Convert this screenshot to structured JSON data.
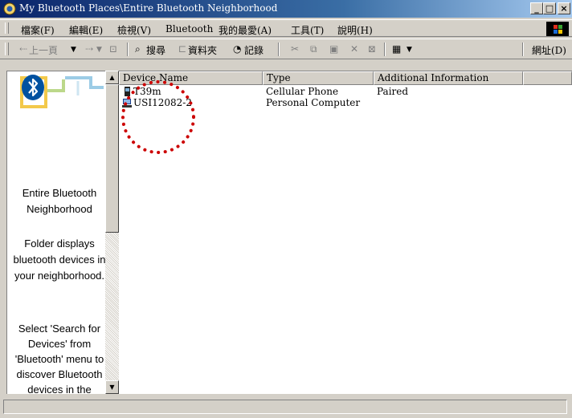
{
  "window": {
    "title": "My Bluetooth Places\\Entire Bluetooth Neighborhood",
    "controls": {
      "minimize": "_",
      "maximize": "□",
      "close": "×"
    }
  },
  "menu": {
    "items": [
      "檔案(F)",
      "編輯(E)",
      "檢視(V)",
      "Bluetooth",
      "我的最愛(A)",
      "工具(T)",
      "說明(H)"
    ]
  },
  "toolbar": {
    "back": "上一頁",
    "search": "搜尋",
    "folders": "資料夾",
    "history": "記錄",
    "address_label": "網址(D)"
  },
  "left_pane": {
    "heading": [
      "Entire Bluetooth",
      "Neighborhood"
    ],
    "description": [
      "Folder displays",
      "bluetooth devices in",
      "your neighborhood."
    ],
    "hint": [
      "Select 'Search for",
      "Devices' from",
      "'Bluetooth' menu to",
      "discover Bluetooth",
      "devices in the"
    ]
  },
  "list": {
    "columns": [
      "Device Name",
      "Type",
      "Additional Information"
    ],
    "rows": [
      {
        "name": "T39m",
        "type": "Cellular Phone",
        "info": "Paired",
        "icon": "cellular-phone-icon"
      },
      {
        "name": "USI12082-2",
        "type": "Personal Computer",
        "info": "",
        "icon": "computer-icon"
      }
    ]
  },
  "colors": {
    "title_bar_start": "#0a246a",
    "title_bar_end": "#a6caf0",
    "annotation": "#cc0000",
    "bluetooth": "#0051a0"
  }
}
